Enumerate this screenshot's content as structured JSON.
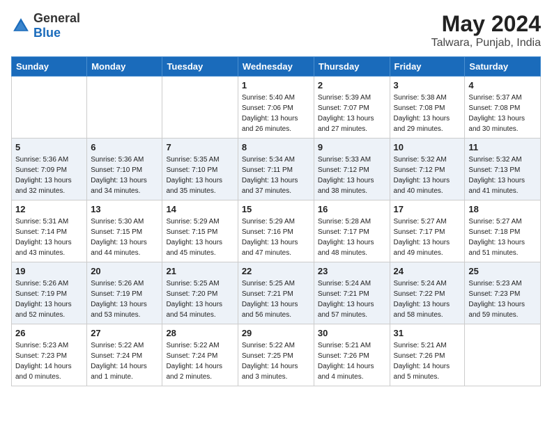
{
  "header": {
    "logo_general": "General",
    "logo_blue": "Blue",
    "month": "May 2024",
    "location": "Talwara, Punjab, India"
  },
  "weekdays": [
    "Sunday",
    "Monday",
    "Tuesday",
    "Wednesday",
    "Thursday",
    "Friday",
    "Saturday"
  ],
  "weeks": [
    [
      {
        "day": "",
        "info": ""
      },
      {
        "day": "",
        "info": ""
      },
      {
        "day": "",
        "info": ""
      },
      {
        "day": "1",
        "info": "Sunrise: 5:40 AM\nSunset: 7:06 PM\nDaylight: 13 hours\nand 26 minutes."
      },
      {
        "day": "2",
        "info": "Sunrise: 5:39 AM\nSunset: 7:07 PM\nDaylight: 13 hours\nand 27 minutes."
      },
      {
        "day": "3",
        "info": "Sunrise: 5:38 AM\nSunset: 7:08 PM\nDaylight: 13 hours\nand 29 minutes."
      },
      {
        "day": "4",
        "info": "Sunrise: 5:37 AM\nSunset: 7:08 PM\nDaylight: 13 hours\nand 30 minutes."
      }
    ],
    [
      {
        "day": "5",
        "info": "Sunrise: 5:36 AM\nSunset: 7:09 PM\nDaylight: 13 hours\nand 32 minutes."
      },
      {
        "day": "6",
        "info": "Sunrise: 5:36 AM\nSunset: 7:10 PM\nDaylight: 13 hours\nand 34 minutes."
      },
      {
        "day": "7",
        "info": "Sunrise: 5:35 AM\nSunset: 7:10 PM\nDaylight: 13 hours\nand 35 minutes."
      },
      {
        "day": "8",
        "info": "Sunrise: 5:34 AM\nSunset: 7:11 PM\nDaylight: 13 hours\nand 37 minutes."
      },
      {
        "day": "9",
        "info": "Sunrise: 5:33 AM\nSunset: 7:12 PM\nDaylight: 13 hours\nand 38 minutes."
      },
      {
        "day": "10",
        "info": "Sunrise: 5:32 AM\nSunset: 7:12 PM\nDaylight: 13 hours\nand 40 minutes."
      },
      {
        "day": "11",
        "info": "Sunrise: 5:32 AM\nSunset: 7:13 PM\nDaylight: 13 hours\nand 41 minutes."
      }
    ],
    [
      {
        "day": "12",
        "info": "Sunrise: 5:31 AM\nSunset: 7:14 PM\nDaylight: 13 hours\nand 43 minutes."
      },
      {
        "day": "13",
        "info": "Sunrise: 5:30 AM\nSunset: 7:15 PM\nDaylight: 13 hours\nand 44 minutes."
      },
      {
        "day": "14",
        "info": "Sunrise: 5:29 AM\nSunset: 7:15 PM\nDaylight: 13 hours\nand 45 minutes."
      },
      {
        "day": "15",
        "info": "Sunrise: 5:29 AM\nSunset: 7:16 PM\nDaylight: 13 hours\nand 47 minutes."
      },
      {
        "day": "16",
        "info": "Sunrise: 5:28 AM\nSunset: 7:17 PM\nDaylight: 13 hours\nand 48 minutes."
      },
      {
        "day": "17",
        "info": "Sunrise: 5:27 AM\nSunset: 7:17 PM\nDaylight: 13 hours\nand 49 minutes."
      },
      {
        "day": "18",
        "info": "Sunrise: 5:27 AM\nSunset: 7:18 PM\nDaylight: 13 hours\nand 51 minutes."
      }
    ],
    [
      {
        "day": "19",
        "info": "Sunrise: 5:26 AM\nSunset: 7:19 PM\nDaylight: 13 hours\nand 52 minutes."
      },
      {
        "day": "20",
        "info": "Sunrise: 5:26 AM\nSunset: 7:19 PM\nDaylight: 13 hours\nand 53 minutes."
      },
      {
        "day": "21",
        "info": "Sunrise: 5:25 AM\nSunset: 7:20 PM\nDaylight: 13 hours\nand 54 minutes."
      },
      {
        "day": "22",
        "info": "Sunrise: 5:25 AM\nSunset: 7:21 PM\nDaylight: 13 hours\nand 56 minutes."
      },
      {
        "day": "23",
        "info": "Sunrise: 5:24 AM\nSunset: 7:21 PM\nDaylight: 13 hours\nand 57 minutes."
      },
      {
        "day": "24",
        "info": "Sunrise: 5:24 AM\nSunset: 7:22 PM\nDaylight: 13 hours\nand 58 minutes."
      },
      {
        "day": "25",
        "info": "Sunrise: 5:23 AM\nSunset: 7:23 PM\nDaylight: 13 hours\nand 59 minutes."
      }
    ],
    [
      {
        "day": "26",
        "info": "Sunrise: 5:23 AM\nSunset: 7:23 PM\nDaylight: 14 hours\nand 0 minutes."
      },
      {
        "day": "27",
        "info": "Sunrise: 5:22 AM\nSunset: 7:24 PM\nDaylight: 14 hours\nand 1 minute."
      },
      {
        "day": "28",
        "info": "Sunrise: 5:22 AM\nSunset: 7:24 PM\nDaylight: 14 hours\nand 2 minutes."
      },
      {
        "day": "29",
        "info": "Sunrise: 5:22 AM\nSunset: 7:25 PM\nDaylight: 14 hours\nand 3 minutes."
      },
      {
        "day": "30",
        "info": "Sunrise: 5:21 AM\nSunset: 7:26 PM\nDaylight: 14 hours\nand 4 minutes."
      },
      {
        "day": "31",
        "info": "Sunrise: 5:21 AM\nSunset: 7:26 PM\nDaylight: 14 hours\nand 5 minutes."
      },
      {
        "day": "",
        "info": ""
      }
    ]
  ]
}
